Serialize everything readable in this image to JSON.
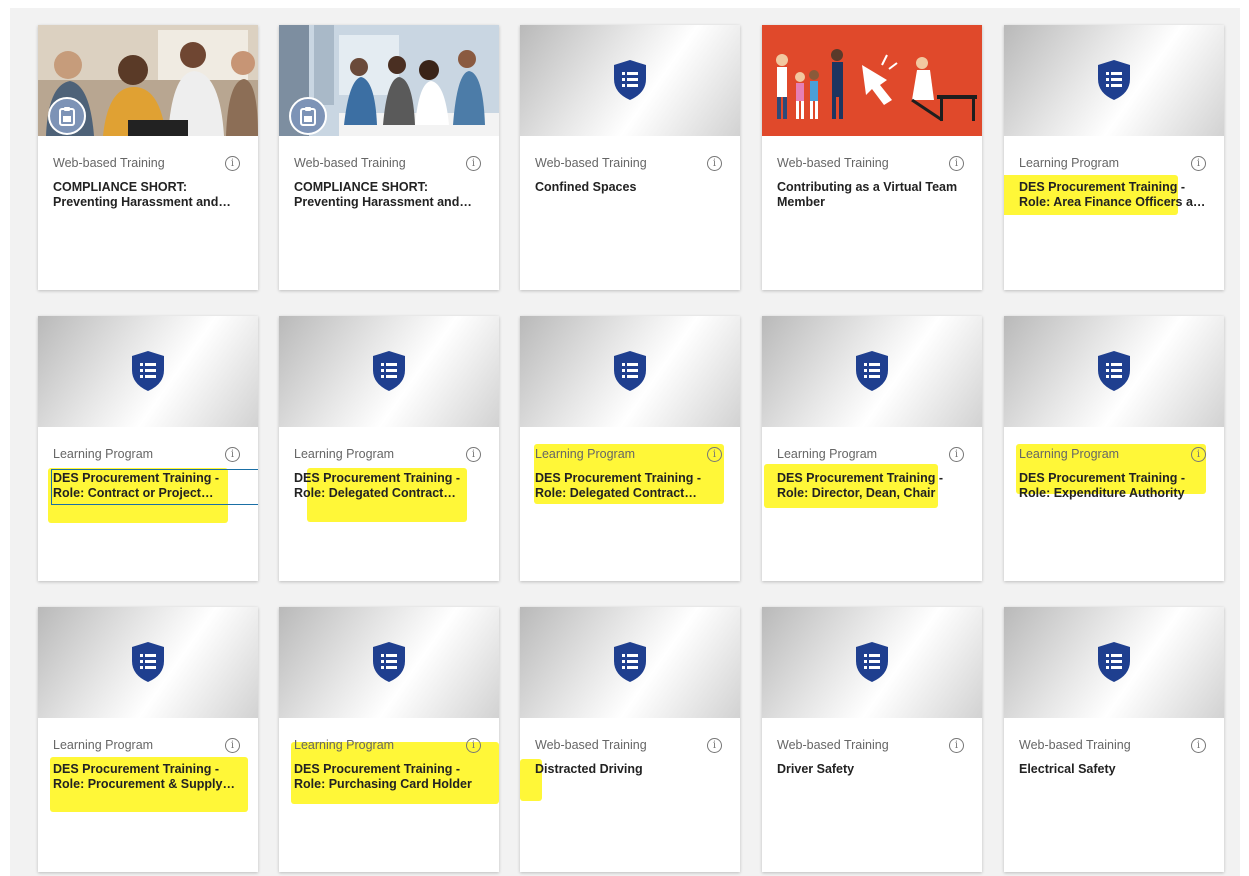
{
  "colors": {
    "shield": "#1f3f8f",
    "highlight": "#fff500",
    "focus_outline": "#1a6fa6",
    "background": "#f2f2f2"
  },
  "info_icon_glyph": "i",
  "cards": [
    {
      "type": "Web-based Training",
      "title": "COMPLIANCE SHORT: Preventing Harassment and Discrimination",
      "thumb": "photo-meeting-icon",
      "info_icon": "info-icon"
    },
    {
      "type": "Web-based Training",
      "title": "COMPLIANCE SHORT: Preventing Harassment and Discrimination",
      "thumb": "photo-office-icon",
      "info_icon": "info-icon"
    },
    {
      "type": "Web-based Training",
      "title": "Confined Spaces",
      "thumb": "shield-list-icon",
      "info_icon": "info-icon"
    },
    {
      "type": "Web-based Training",
      "title": "Contributing as a Virtual Team Member",
      "thumb": "illustration-icon",
      "info_icon": "info-icon"
    },
    {
      "type": "Learning Program",
      "title": "DES Procurement Training - Role: Area Finance Officers and Administrators",
      "thumb": "shield-list-icon",
      "info_icon": "info-icon"
    },
    {
      "type": "Learning Program",
      "title": "DES Procurement Training - Role: Contract or Project Manager",
      "thumb": "shield-list-icon",
      "info_icon": "info-icon"
    },
    {
      "type": "Learning Program",
      "title": "DES Procurement Training - Role: Delegated Contract Signatory",
      "thumb": "shield-list-icon",
      "info_icon": "info-icon"
    },
    {
      "type": "Learning Program",
      "title": "DES Procurement Training - Role: Delegated Contract Approver",
      "thumb": "shield-list-icon",
      "info_icon": "info-icon"
    },
    {
      "type": "Learning Program",
      "title": "DES Procurement Training - Role: Director, Dean, Chair",
      "thumb": "shield-list-icon",
      "info_icon": "info-icon"
    },
    {
      "type": "Learning Program",
      "title": "DES Procurement Training - Role: Expenditure Authority",
      "thumb": "shield-list-icon",
      "info_icon": "info-icon"
    },
    {
      "type": "Learning Program",
      "title": "DES Procurement Training - Role: Procurement & Supply Chain Staff",
      "thumb": "shield-list-icon",
      "info_icon": "info-icon"
    },
    {
      "type": "Learning Program",
      "title": "DES Procurement Training - Role: Purchasing Card Holder",
      "thumb": "shield-list-icon",
      "info_icon": "info-icon"
    },
    {
      "type": "Web-based Training",
      "title": "Distracted Driving",
      "thumb": "shield-list-icon",
      "info_icon": "info-icon"
    },
    {
      "type": "Web-based Training",
      "title": "Driver Safety",
      "thumb": "shield-list-icon",
      "info_icon": "info-icon"
    },
    {
      "type": "Web-based Training",
      "title": "Electrical Safety",
      "thumb": "shield-list-icon",
      "info_icon": "info-icon"
    }
  ]
}
